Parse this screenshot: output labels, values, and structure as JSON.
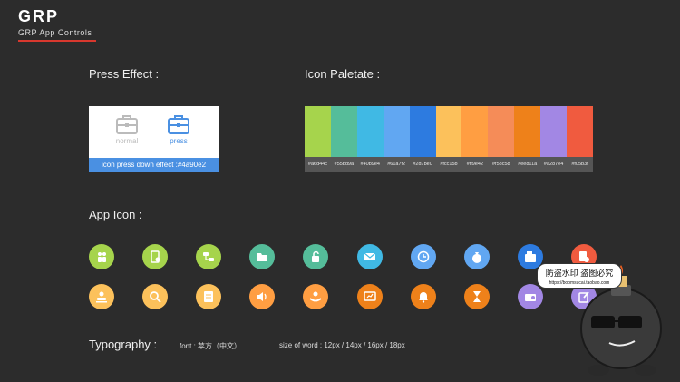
{
  "brand": {
    "title": "GRP",
    "subtitle": "GRP App Controls",
    "accent": "#d8382e"
  },
  "press_effect": {
    "title": "Press Effect :",
    "normal_label": "normal",
    "press_label": "press",
    "caption": "icon press down effect :#4a90e2",
    "normal_color": "#bbbbbb",
    "press_color": "#4a90e2",
    "icon": "briefcase-icon"
  },
  "palette": {
    "title": "Icon Paletate :",
    "colors": [
      {
        "hex": "#a6d44c",
        "label": "#a6d44c"
      },
      {
        "hex": "#55bd9a",
        "label": "#55bd9a"
      },
      {
        "hex": "#40b9e4",
        "label": "#40b9e4"
      },
      {
        "hex": "#61a7f2",
        "label": "#61a7f2"
      },
      {
        "hex": "#2d7be0",
        "label": "#2d7be0"
      },
      {
        "hex": "#fcc15b",
        "label": "#fcc15b"
      },
      {
        "hex": "#ff9e42",
        "label": "#ff9e42"
      },
      {
        "hex": "#f58c58",
        "label": "#f58c58"
      },
      {
        "hex": "#ee811a",
        "label": "#ee811a"
      },
      {
        "hex": "#a287e4",
        "label": "#a287e4"
      },
      {
        "hex": "#f05b3f",
        "label": "#f05b3f"
      }
    ]
  },
  "app_icons": {
    "title": "App Icon :",
    "rows": [
      [
        {
          "name": "people-icon",
          "color": "#a6d44c"
        },
        {
          "name": "phone-document-icon",
          "color": "#a6d44c"
        },
        {
          "name": "flow-icon",
          "color": "#a6d44c"
        },
        {
          "name": "folder-icon",
          "color": "#55bd9a"
        },
        {
          "name": "unlock-icon",
          "color": "#55bd9a"
        },
        {
          "name": "mail-icon",
          "color": "#40b9e4"
        },
        {
          "name": "clock-icon",
          "color": "#61a7f2"
        },
        {
          "name": "money-bag-icon",
          "color": "#61a7f2"
        },
        {
          "name": "register-icon",
          "color": "#2d7be0"
        },
        {
          "name": "document-settings-icon",
          "color": "#f05b3f"
        }
      ],
      [
        {
          "name": "stamp-icon",
          "color": "#fcc15b"
        },
        {
          "name": "search-icon",
          "color": "#fcc15b"
        },
        {
          "name": "document-list-icon",
          "color": "#fcc15b"
        },
        {
          "name": "volume-icon",
          "color": "#ff9e42"
        },
        {
          "name": "hand-person-icon",
          "color": "#ff9e42"
        },
        {
          "name": "chart-board-icon",
          "color": "#ee811a"
        },
        {
          "name": "bell-icon",
          "color": "#ee811a"
        },
        {
          "name": "hourglass-icon",
          "color": "#ee811a"
        },
        {
          "name": "radio-icon",
          "color": "#a287e4"
        },
        {
          "name": "edit-icon",
          "color": "#a287e4"
        }
      ]
    ]
  },
  "typography": {
    "title": "Typography :",
    "font": "font : 苹方（中文）",
    "sizes": "size of word : 12px / 14px / 16px / 18px"
  },
  "watermark": {
    "text": "防盗水印 盗图必究",
    "url": "https://boomsucai.taobao.com"
  }
}
